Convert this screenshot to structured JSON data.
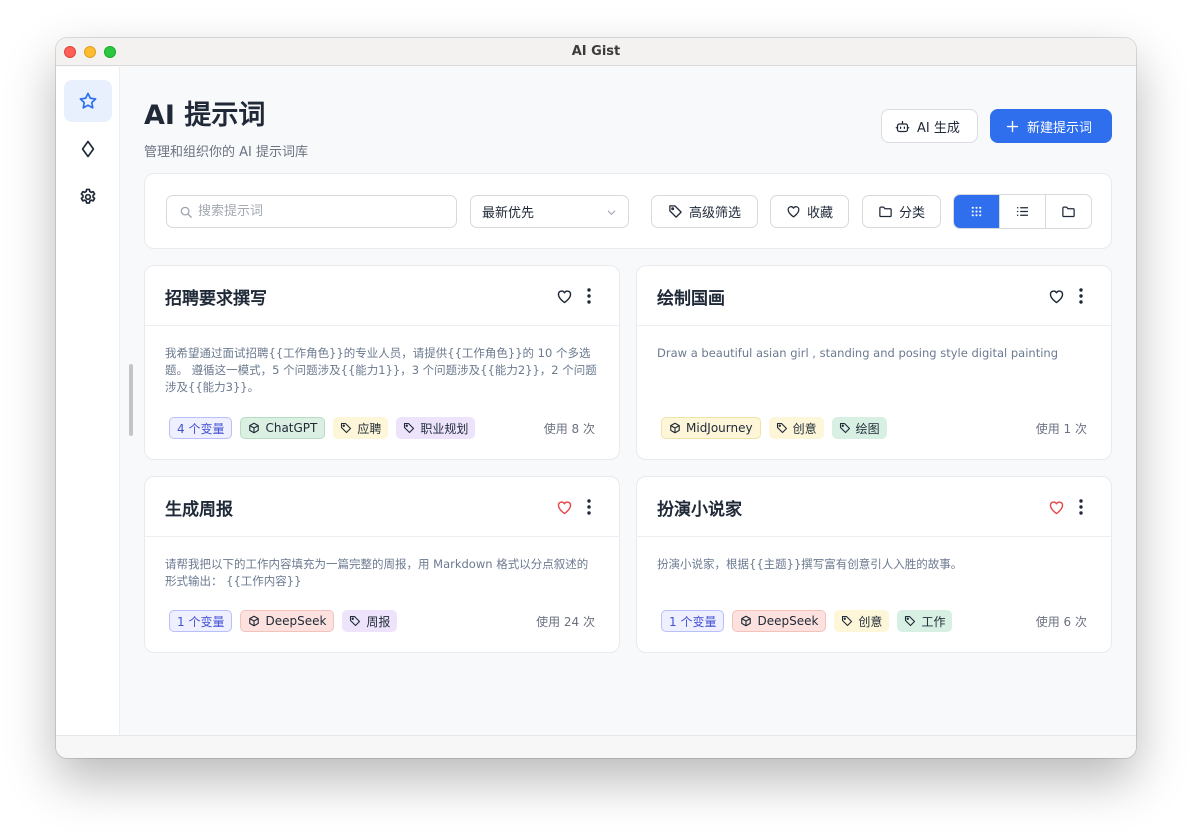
{
  "window": {
    "title": "AI Gist"
  },
  "sidebar": {
    "items": [
      {
        "name": "prompts",
        "icon": "star-icon",
        "active": true
      },
      {
        "name": "models",
        "icon": "diamond-icon",
        "active": false
      },
      {
        "name": "settings",
        "icon": "gear-icon",
        "active": false
      }
    ]
  },
  "header": {
    "title": "AI 提示词",
    "subtitle": "管理和组织你的 AI 提示词库",
    "ai_generate_label": "AI 生成",
    "new_prompt_label": "新建提示词"
  },
  "toolbar": {
    "search_placeholder": "搜索提示词",
    "sort_value": "最新优先",
    "advanced_filter_label": "高级筛选",
    "favorites_label": "收藏",
    "category_label": "分类",
    "active_view": "grid"
  },
  "cards": [
    {
      "title": "招聘要求撰写",
      "favorited": false,
      "description": "我希望通过面试招聘{{工作角色}}的专业人员，请提供{{工作角色}}的 10 个多选题。 遵循这一模式，5 个问题涉及{{能力1}}，3 个问题涉及{{能力2}}，2 个问题涉及{{能力3}}。",
      "variables": "4 个变量",
      "model": "ChatGPT",
      "tags": [
        "应聘",
        "职业规划"
      ],
      "usage": "使用 8 次"
    },
    {
      "title": "绘制国画",
      "favorited": false,
      "description": "Draw a beautiful asian girl , standing and posing style digital painting",
      "variables": "",
      "model": "MidJourney",
      "tags": [
        "创意",
        "绘图"
      ],
      "usage": "使用 1 次"
    },
    {
      "title": "生成周报",
      "favorited": true,
      "description": "请帮我把以下的工作内容填充为一篇完整的周报，用 Markdown 格式以分点叙述的形式输出： {{工作内容}}",
      "variables": "1 个变量",
      "model": "DeepSeek",
      "tags": [
        "周报"
      ],
      "usage": "使用 24 次"
    },
    {
      "title": "扮演小说家",
      "favorited": true,
      "description": "扮演小说家，根据{{主题}}撰写富有创意引人入胜的故事。",
      "variables": "1 个变量",
      "model": "DeepSeek",
      "tags": [
        "创意",
        "工作"
      ],
      "usage": "使用 6 次"
    }
  ],
  "colors": {
    "accent": "#2f6fed",
    "heart_active": "#e5484d"
  }
}
